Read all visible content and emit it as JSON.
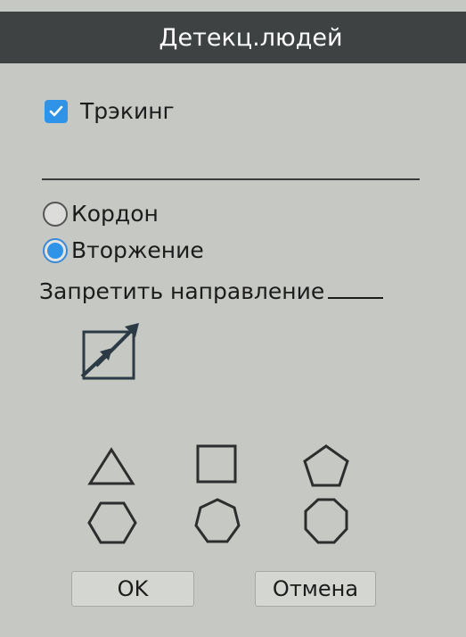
{
  "window": {
    "title": "Детекц.людей"
  },
  "tracking": {
    "label": "Трэкинг",
    "checked": true
  },
  "mode": {
    "options": [
      {
        "label": "Кордон",
        "selected": false
      },
      {
        "label": "Вторжение",
        "selected": true
      }
    ]
  },
  "direction": {
    "label": "Запретить направление"
  },
  "shapes": {
    "items": [
      "triangle-icon",
      "square-icon",
      "pentagon-icon",
      "hexagon-icon",
      "heptagon-icon",
      "octagon-icon"
    ]
  },
  "buttons": {
    "ok_label": "OK",
    "cancel_label": "Отмена"
  },
  "colors": {
    "accent": "#2f93e8",
    "titlebar": "#3f4243",
    "background": "#c6c8c4"
  }
}
